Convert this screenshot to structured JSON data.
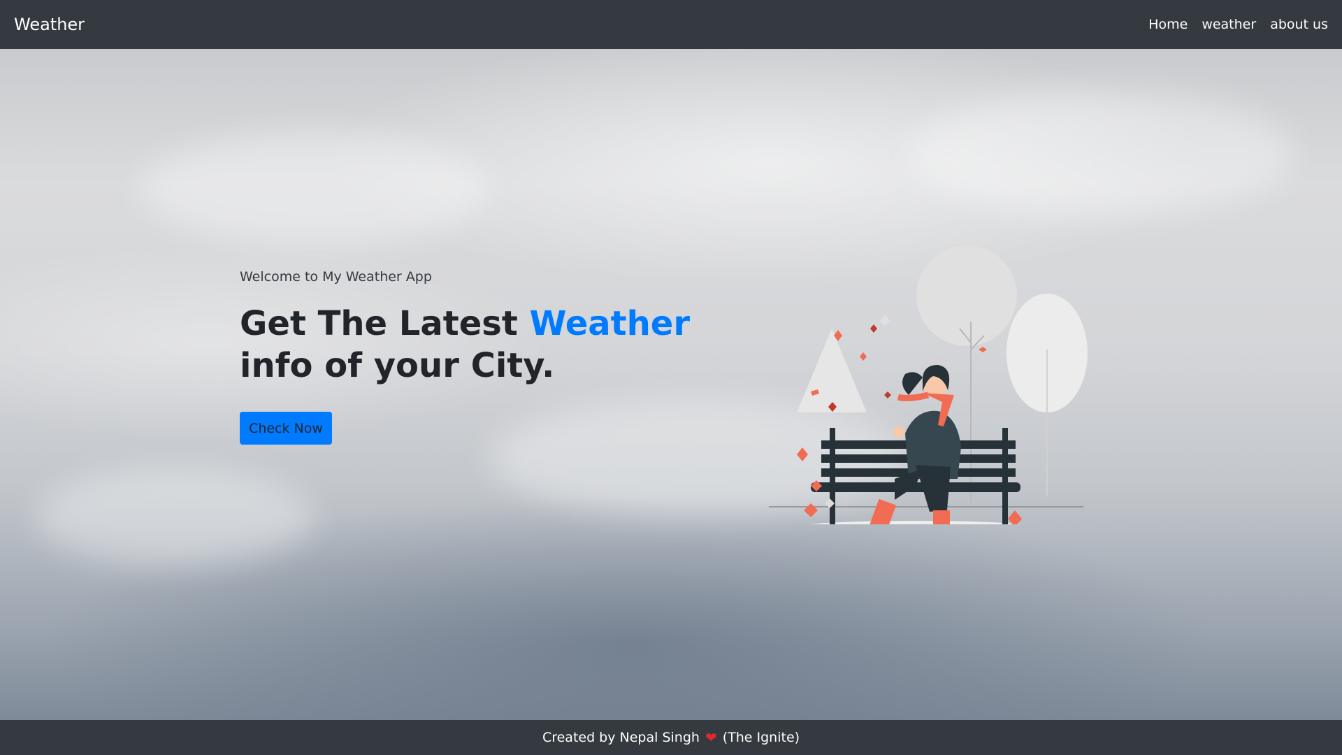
{
  "navbar": {
    "brand": "Weather",
    "links": [
      "Home",
      "weather",
      "about us"
    ]
  },
  "hero": {
    "welcome": "Welcome to My Weather App",
    "headline_before": "Get The Latest ",
    "headline_accent": "Weather",
    "headline_after": " info of your City.",
    "button_label": "Check Now",
    "illustration_icon": "woman-on-bench-autumn-illustration"
  },
  "footer": {
    "prefix": "Created by Nepal Singh",
    "icon": "heart-icon",
    "suffix": "(The Ignite)"
  },
  "colors": {
    "nav_bg": "#343a40",
    "accent": "#007bff",
    "heart": "#e0282f"
  }
}
